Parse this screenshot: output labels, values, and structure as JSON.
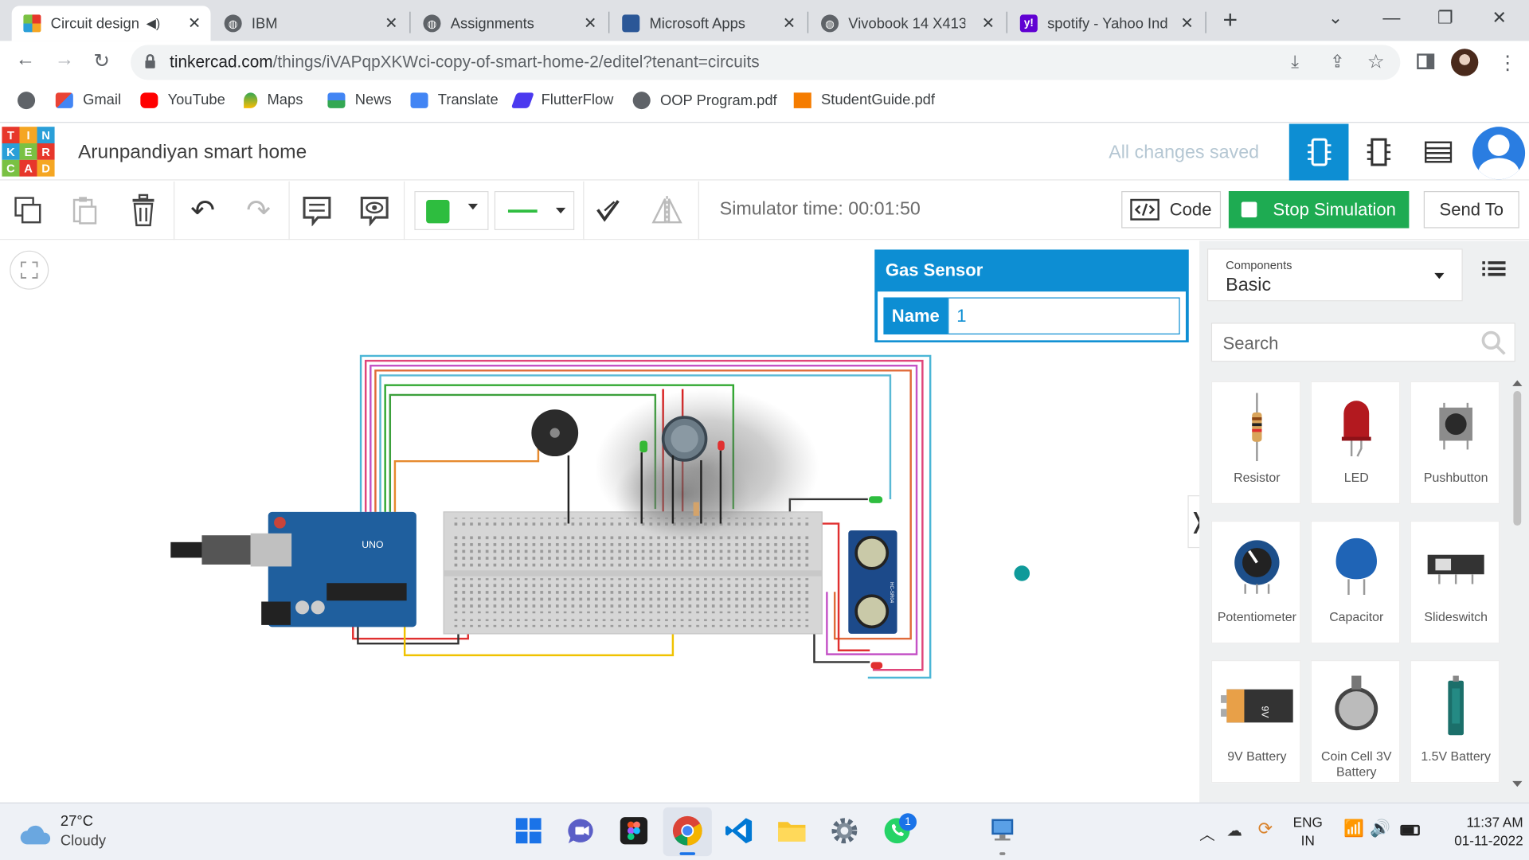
{
  "browser": {
    "tabs": [
      {
        "title": "Circuit design (",
        "active": true,
        "audio_icon": "speaker-icon"
      },
      {
        "title": "IBM"
      },
      {
        "title": "Assignments"
      },
      {
        "title": "Microsoft Apps"
      },
      {
        "title": "Vivobook 14 X413"
      },
      {
        "title": "spotify - Yahoo Ind"
      }
    ],
    "new_tab_label": "+",
    "url_host": "tinkercad.com",
    "url_path": "/things/iVAPqpXKWci-copy-of-smart-home-2/editel?tenant=circuits",
    "bookmarks": [
      {
        "label": "Gmail"
      },
      {
        "label": "YouTube"
      },
      {
        "label": "Maps"
      },
      {
        "label": "News"
      },
      {
        "label": "Translate"
      },
      {
        "label": "FlutterFlow"
      },
      {
        "label": "OOP Program.pdf"
      },
      {
        "label": "StudentGuide.pdf"
      }
    ]
  },
  "app": {
    "logo_letters": [
      "T",
      "I",
      "N",
      "K",
      "E",
      "R",
      "C",
      "A",
      "D"
    ],
    "project_title": "Arunpandiyan smart home",
    "save_status": "All changes saved",
    "toolbar": {
      "simulator_time": "Simulator time: 00:01:50",
      "code_label": "Code",
      "stop_label": "Stop Simulation",
      "send_label": "Send To"
    },
    "inspector": {
      "title": "Gas Sensor",
      "name_label": "Name",
      "name_value": "1"
    },
    "components": {
      "selector_label": "Components",
      "selector_value": "Basic",
      "search_placeholder": "Search",
      "items": [
        {
          "label": "Resistor",
          "icon": "resistor-icon"
        },
        {
          "label": "LED",
          "icon": "led-icon"
        },
        {
          "label": "Pushbutton",
          "icon": "pushbutton-icon"
        },
        {
          "label": "Potentiometer",
          "icon": "potentiometer-icon"
        },
        {
          "label": "Capacitor",
          "icon": "capacitor-icon"
        },
        {
          "label": "Slideswitch",
          "icon": "slideswitch-icon"
        },
        {
          "label": "9V Battery",
          "icon": "9v-battery-icon"
        },
        {
          "label": "Coin Cell 3V Battery",
          "icon": "coin-cell-icon"
        },
        {
          "label": "1.5V Battery",
          "icon": "aa-battery-icon"
        }
      ]
    },
    "circuit": {
      "arduino_label": "UNO",
      "ultrasonic_label": "HC-SR04",
      "battery_text": "9V"
    }
  },
  "taskbar": {
    "weather_temp": "27°C",
    "weather_desc": "Cloudy",
    "lang_top": "ENG",
    "lang_bottom": "IN",
    "time": "11:37 AM",
    "date": "01-11-2022",
    "whatsapp_badge": "1"
  }
}
